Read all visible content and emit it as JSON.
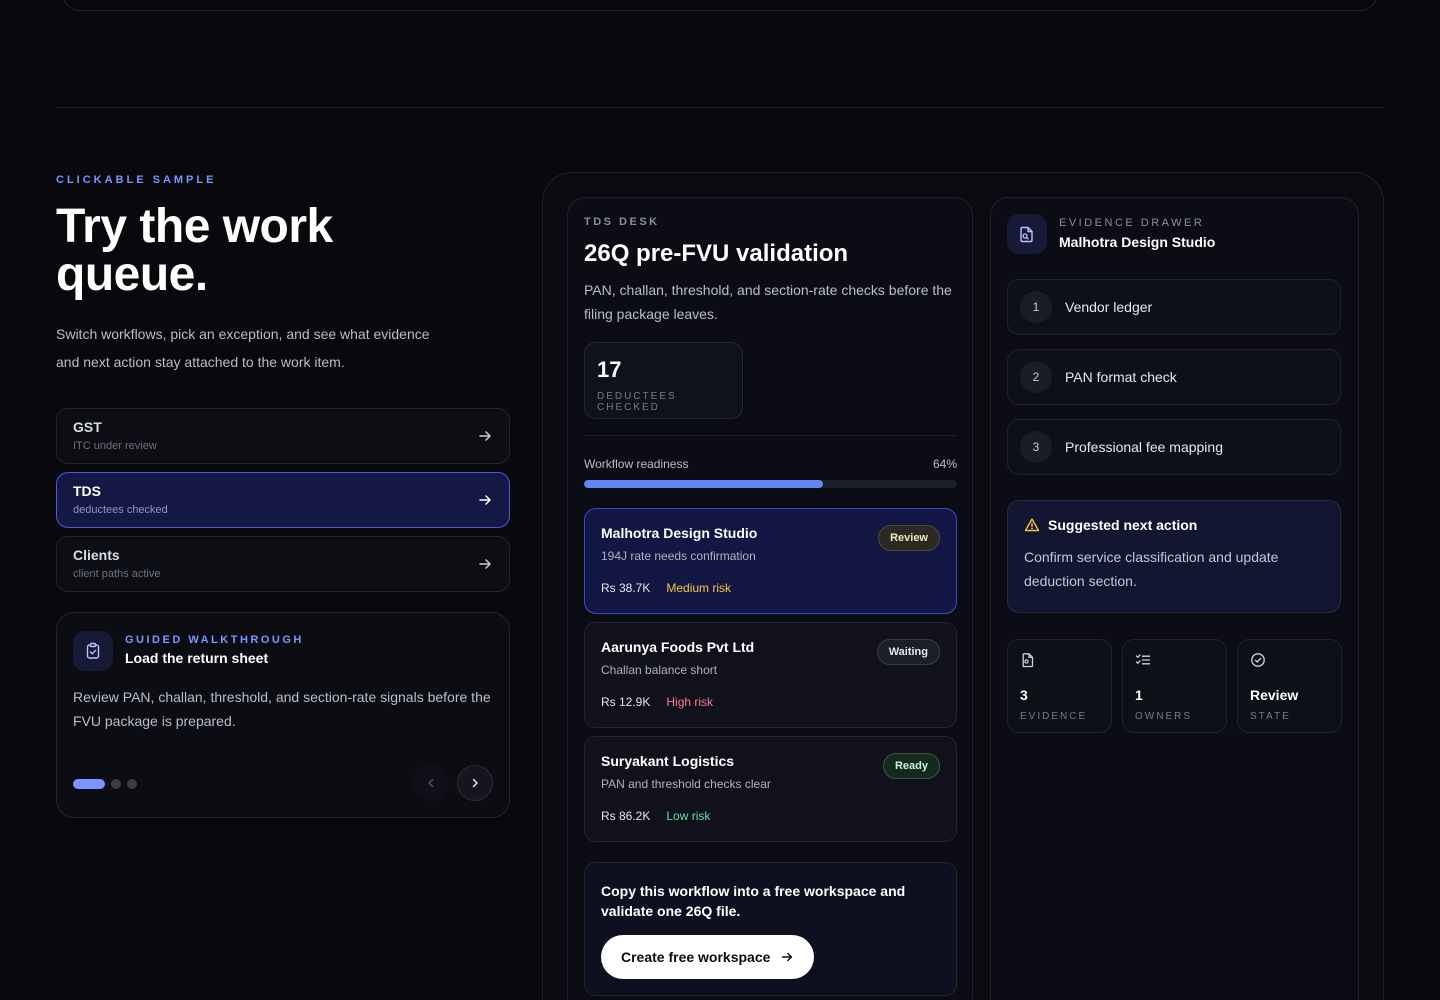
{
  "section": {
    "eyebrow": "CLICKABLE SAMPLE",
    "title": "Try the work queue.",
    "subtitle": "Switch workflows, pick an exception, and see what evidence and next action stay attached to the work item."
  },
  "workflows": [
    {
      "title": "GST",
      "subtitle": "ITC under review",
      "active": false
    },
    {
      "title": "TDS",
      "subtitle": "deductees checked",
      "active": true
    },
    {
      "title": "Clients",
      "subtitle": "client paths active",
      "active": false
    }
  ],
  "walkthrough": {
    "eyebrow": "GUIDED WALKTHROUGH",
    "title": "Load the return sheet",
    "body": "Review PAN, challan, threshold, and section-rate signals before the FVU package is prepared.",
    "step_count": 3,
    "active_step": 1
  },
  "desk": {
    "eyebrow": "TDS DESK",
    "title": "26Q pre-FVU validation",
    "subtitle": "PAN, challan, threshold, and section-rate checks before the filing package leaves.",
    "stat_value": "17",
    "stat_label": "DEDUCTEES CHECKED",
    "readiness_label": "Workflow readiness",
    "readiness_pct_text": "64%",
    "readiness_value": 0.64
  },
  "exceptions": [
    {
      "name": "Malhotra Design Studio",
      "note": "194J rate needs confirmation",
      "amount": "Rs 38.7K",
      "risk": "Medium risk",
      "risk_color": "#f5c542",
      "badge": "Review",
      "badge_kind": "review",
      "active": true
    },
    {
      "name": "Aarunya Foods Pvt Ltd",
      "note": "Challan balance short",
      "amount": "Rs 12.9K",
      "risk": "High risk",
      "risk_color": "#ff7a93",
      "badge": "Waiting",
      "badge_kind": "waiting",
      "active": false
    },
    {
      "name": "Suryakant Logistics",
      "note": "PAN and threshold checks clear",
      "amount": "Rs 86.2K",
      "risk": "Low risk",
      "risk_color": "#5fe0a0",
      "badge": "Ready",
      "badge_kind": "ready",
      "active": false
    }
  ],
  "cta": {
    "text": "Copy this workflow into a free workspace and validate one 26Q file.",
    "button_label": "Create free workspace"
  },
  "drawer": {
    "eyebrow": "EVIDENCE DRAWER",
    "title": "Malhotra Design Studio",
    "steps": [
      {
        "num": "1",
        "label": "Vendor ledger"
      },
      {
        "num": "2",
        "label": "PAN format check"
      },
      {
        "num": "3",
        "label": "Professional fee mapping"
      }
    ],
    "suggestion_title": "Suggested next action",
    "suggestion_body": "Confirm service classification and update deduction section.",
    "stats": [
      {
        "value": "3",
        "label": "EVIDENCE",
        "icon": "file-icon"
      },
      {
        "value": "1",
        "label": "OWNERS",
        "icon": "checklist-icon"
      },
      {
        "value": "Review",
        "label": "STATE",
        "icon": "check-circle-icon"
      }
    ]
  },
  "colors": {
    "accent": "#7c95ff",
    "progress": "#6286f7",
    "warning": "#f5c542"
  }
}
